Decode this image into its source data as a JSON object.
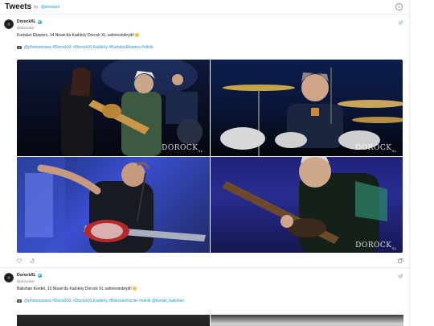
{
  "header": {
    "title": "Tweets",
    "by": "by",
    "handle": "@dorockxl",
    "info_icon": "info-icon"
  },
  "tweets": [
    {
      "author_name": "DorockXL",
      "author_handle": "@dorockxl",
      "text": "Kurtalan Ekspres, 14 Nisan'da Kadıköy Dorock XL sahnesindeydi!",
      "links": "@photosunsea #DorockXL #DorockXLKadıköy #KurtalanEkspres #etkilir",
      "watermark": "DOROCK",
      "watermark_sub": "XL",
      "actions": [
        "like-icon",
        "share-icon",
        "image-stack-icon"
      ]
    },
    {
      "author_name": "DorockXL",
      "author_handle": "@dorockxl",
      "text": "Balishan Kordel, 13 Nisan'da Kadıköy Dorock XL sahnesindeydi!",
      "links": "@photosunsea #DorockXL #DorockXLKadıköy #BalishanKordel #etkilir @kordel_balishan"
    }
  ],
  "colors": {
    "link": "#1b95e0",
    "text": "#14171a",
    "muted": "#657786",
    "divider": "#e6ecf0",
    "verified": "#1da1f2"
  }
}
